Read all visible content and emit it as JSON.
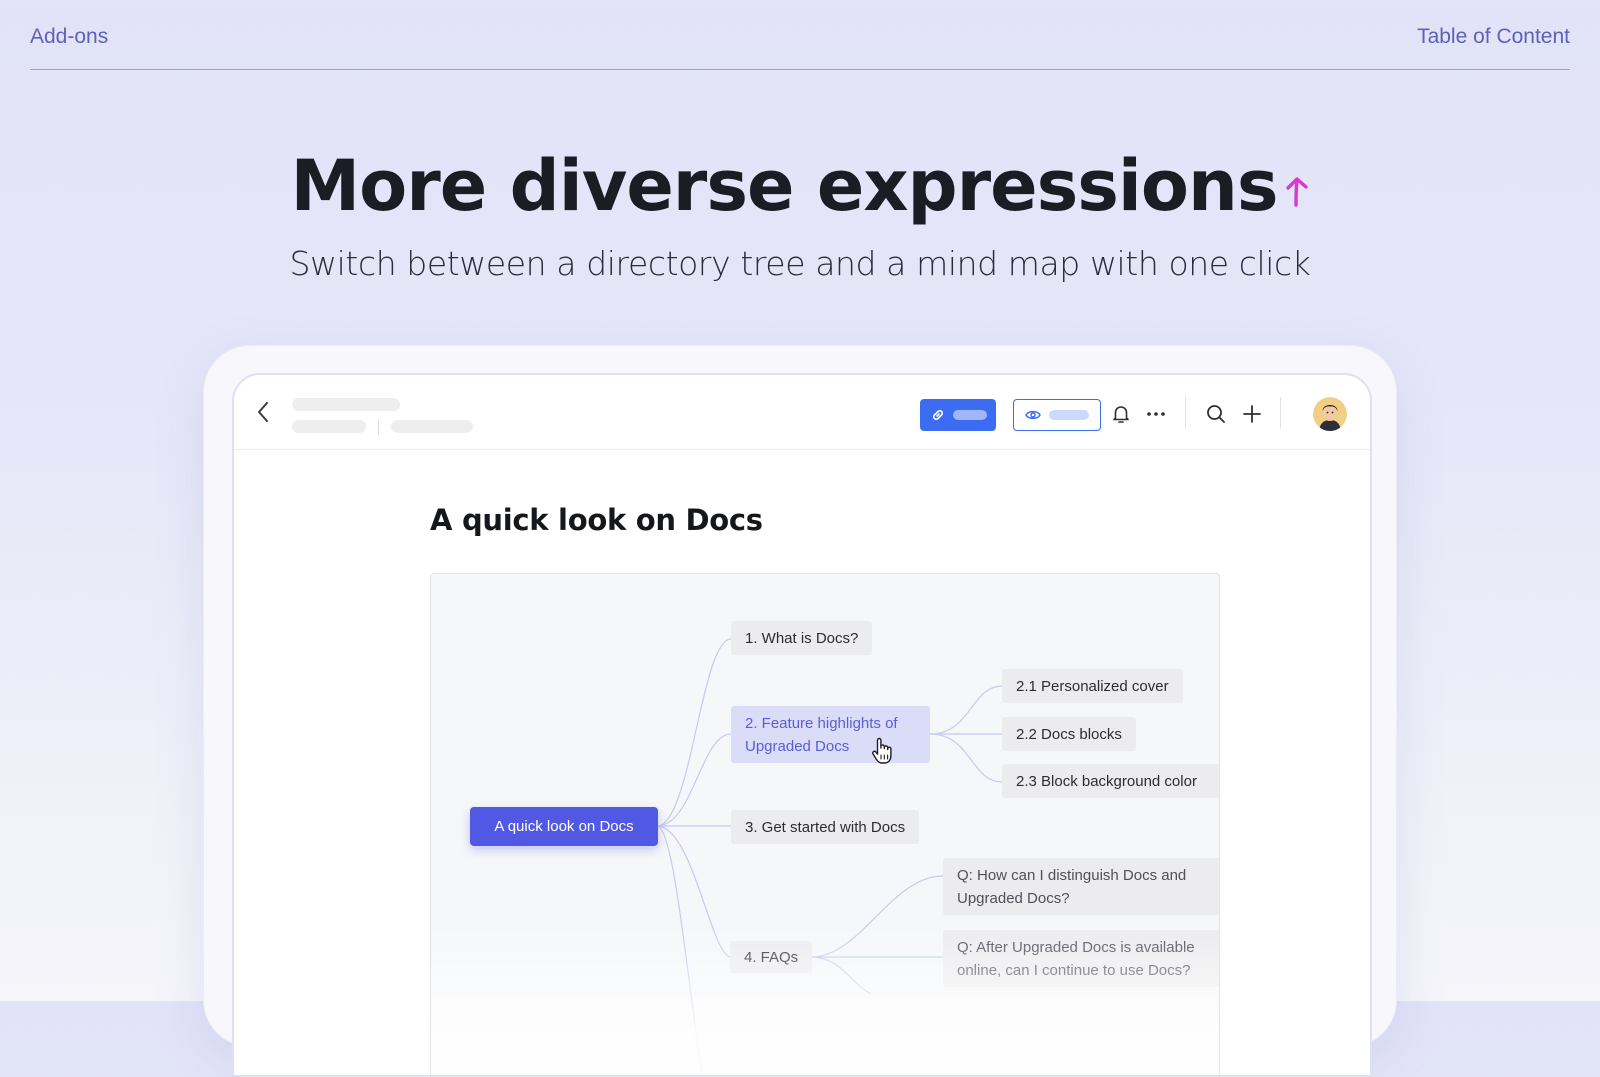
{
  "nav": {
    "left_label": "Add-ons",
    "right_label": "Table of Content"
  },
  "hero": {
    "title": "More diverse expressions",
    "subtitle": "Switch between a directory tree and a mind map with one click"
  },
  "colors": {
    "accent": "#5159e4",
    "brand_blue": "#3c6cf2",
    "arrow": "#d63ad0",
    "nav_text": "#5d62b9"
  },
  "app": {
    "header_icons": [
      "back-icon",
      "link-icon",
      "eye-icon",
      "bell-icon",
      "more-icon",
      "search-icon",
      "plus-icon"
    ],
    "document_title": "A quick look on Docs",
    "mindmap": {
      "root": "A quick look on Docs",
      "branches": [
        {
          "label": "1. What is Docs?"
        },
        {
          "label": "2. Feature highlights of Upgraded Docs",
          "selected": true,
          "children": [
            "2.1 Personalized cover",
            "2.2 Docs blocks",
            "2.3 Block background color"
          ]
        },
        {
          "label": "3. Get started with Docs"
        },
        {
          "label": "4. FAQs",
          "children": [
            "Q: How can I distinguish Docs and Upgraded Docs?",
            "Q: After Upgraded Docs is available online, can I continue to use Docs?"
          ]
        }
      ]
    }
  }
}
